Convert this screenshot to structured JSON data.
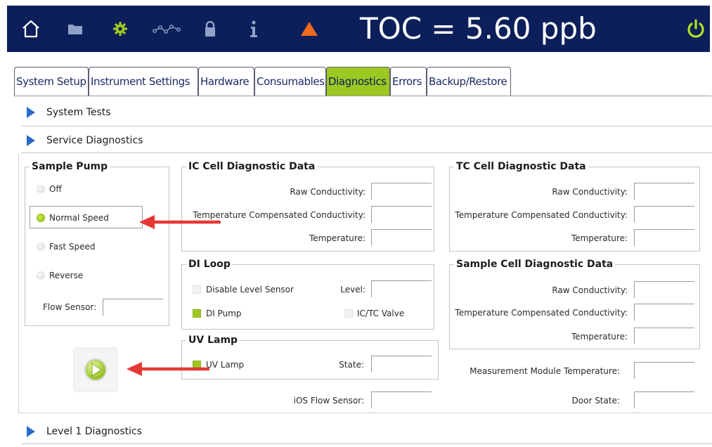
{
  "topbar": {
    "toc_readout": "TOC = 5.60 ppb",
    "icons": [
      "home-icon",
      "folder-icon",
      "gear-icon",
      "trend-icon",
      "lock-icon",
      "info-icon",
      "warning-icon",
      "power-icon"
    ]
  },
  "tabs": [
    {
      "label": "System Setup"
    },
    {
      "label": "Instrument Settings"
    },
    {
      "label": "Hardware"
    },
    {
      "label": "Consumables"
    },
    {
      "label": "Diagnostics",
      "active": true
    },
    {
      "label": "Errors"
    },
    {
      "label": "Backup/Restore"
    }
  ],
  "sections": {
    "system_tests": "System Tests",
    "service_diagnostics": "Service Diagnostics",
    "level1_diagnostics": "Level 1 Diagnostics"
  },
  "sample_pump": {
    "title": "Sample Pump",
    "options": [
      {
        "label": "Off",
        "selected": false
      },
      {
        "label": "Normal Speed",
        "selected": true
      },
      {
        "label": "Fast Speed",
        "selected": false
      },
      {
        "label": "Reverse",
        "selected": false
      }
    ],
    "flow_sensor_label": "Flow Sensor:"
  },
  "ic_cell": {
    "title": "IC Cell Diagnostic Data",
    "raw_label": "Raw Conductivity:",
    "tcomp_label": "Temperature Compensated Conductivity:",
    "temp_label": "Temperature:"
  },
  "tc_cell": {
    "title": "TC Cell Diagnostic Data",
    "raw_label": "Raw Conductivity:",
    "tcomp_label": "Temperature Compensated Conductivity:",
    "temp_label": "Temperature:"
  },
  "di_loop": {
    "title": "DI Loop",
    "disable_level_sensor": {
      "label": "Disable Level Sensor",
      "checked": false
    },
    "level_label": "Level:",
    "di_pump": {
      "label": "DI Pump",
      "checked": true
    },
    "ictc_valve": {
      "label": "IC/TC Valve",
      "checked": false
    }
  },
  "sample_cell": {
    "title": "Sample Cell Diagnostic Data",
    "raw_label": "Raw Conductivity:",
    "tcomp_label": "Temperature Compensated Conductivity:",
    "temp_label": "Temperature:"
  },
  "uv_lamp": {
    "title": "UV Lamp",
    "uv_lamp_check": {
      "label": "UV Lamp",
      "checked": true
    },
    "state_label": "State:"
  },
  "misc": {
    "ios_flow_sensor_label": "iOS Flow Sensor:",
    "measurement_module_temp_label": "Measurement Module Temperature:",
    "door_state_label": "Door State:"
  },
  "colors": {
    "topbar_bg": "#0c1f5a",
    "accent_green": "#9cc822",
    "warning_orange": "#f26a1b",
    "annotation_red": "#e53935",
    "accordion_triangle": "#2a6cc4"
  }
}
